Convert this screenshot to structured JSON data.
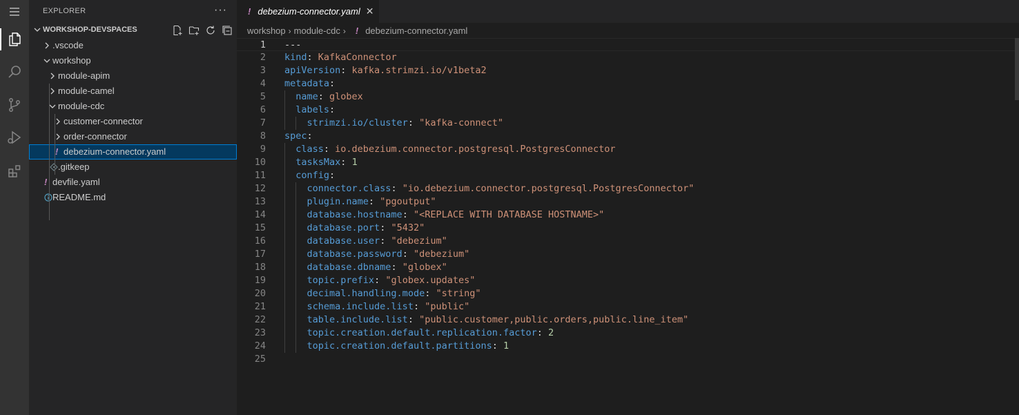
{
  "sidebar": {
    "title": "EXPLORER",
    "more_label": "···",
    "section_title": "WORKSHOP-DEVSPACES",
    "tree": [
      {
        "label": ".vscode",
        "type": "folder",
        "expanded": false,
        "depth": 0
      },
      {
        "label": "workshop",
        "type": "folder",
        "expanded": true,
        "depth": 0
      },
      {
        "label": "module-apim",
        "type": "folder",
        "expanded": false,
        "depth": 1
      },
      {
        "label": "module-camel",
        "type": "folder",
        "expanded": false,
        "depth": 1
      },
      {
        "label": "module-cdc",
        "type": "folder",
        "expanded": true,
        "depth": 1
      },
      {
        "label": "customer-connector",
        "type": "folder",
        "expanded": false,
        "depth": 2
      },
      {
        "label": "order-connector",
        "type": "folder",
        "expanded": false,
        "depth": 2
      },
      {
        "label": "debezium-connector.yaml",
        "type": "yaml",
        "depth": 2,
        "selected": true
      },
      {
        "label": ".gitkeep",
        "type": "gitkeep",
        "depth": 1
      },
      {
        "label": "devfile.yaml",
        "type": "yaml",
        "depth": 0
      },
      {
        "label": "README.md",
        "type": "info",
        "depth": 0
      }
    ]
  },
  "editor": {
    "tab_label": "debezium-connector.yaml",
    "tab_icon": "!",
    "close_glyph": "✕",
    "breadcrumbs": [
      "workshop",
      "module-cdc",
      "debezium-connector.yaml"
    ],
    "breadcrumb_sep": "›",
    "current_line": 1,
    "lines": [
      [
        [
          "p",
          "---"
        ]
      ],
      [
        [
          "k",
          "kind"
        ],
        [
          "p",
          ": "
        ],
        [
          "s",
          "KafkaConnector"
        ]
      ],
      [
        [
          "k",
          "apiVersion"
        ],
        [
          "p",
          ": "
        ],
        [
          "s",
          "kafka.strimzi.io/v1beta2"
        ]
      ],
      [
        [
          "k",
          "metadata"
        ],
        [
          "p",
          ":"
        ]
      ],
      [
        [
          "p",
          "  "
        ],
        [
          "k",
          "name"
        ],
        [
          "p",
          ": "
        ],
        [
          "s",
          "globex"
        ]
      ],
      [
        [
          "p",
          "  "
        ],
        [
          "k",
          "labels"
        ],
        [
          "p",
          ":"
        ]
      ],
      [
        [
          "p",
          "    "
        ],
        [
          "k",
          "strimzi.io/cluster"
        ],
        [
          "p",
          ": "
        ],
        [
          "s",
          "\"kafka-connect\""
        ]
      ],
      [
        [
          "k",
          "spec"
        ],
        [
          "p",
          ":"
        ]
      ],
      [
        [
          "p",
          "  "
        ],
        [
          "k",
          "class"
        ],
        [
          "p",
          ": "
        ],
        [
          "s",
          "io.debezium.connector.postgresql.PostgresConnector"
        ]
      ],
      [
        [
          "p",
          "  "
        ],
        [
          "k",
          "tasksMax"
        ],
        [
          "p",
          ": "
        ],
        [
          "n",
          "1"
        ]
      ],
      [
        [
          "p",
          "  "
        ],
        [
          "k",
          "config"
        ],
        [
          "p",
          ":"
        ]
      ],
      [
        [
          "p",
          "    "
        ],
        [
          "k",
          "connector.class"
        ],
        [
          "p",
          ": "
        ],
        [
          "s",
          "\"io.debezium.connector.postgresql.PostgresConnector\""
        ]
      ],
      [
        [
          "p",
          "    "
        ],
        [
          "k",
          "plugin.name"
        ],
        [
          "p",
          ": "
        ],
        [
          "s",
          "\"pgoutput\""
        ]
      ],
      [
        [
          "p",
          "    "
        ],
        [
          "k",
          "database.hostname"
        ],
        [
          "p",
          ": "
        ],
        [
          "s",
          "\"<REPLACE WITH DATABASE HOSTNAME>\""
        ]
      ],
      [
        [
          "p",
          "    "
        ],
        [
          "k",
          "database.port"
        ],
        [
          "p",
          ": "
        ],
        [
          "s",
          "\"5432\""
        ]
      ],
      [
        [
          "p",
          "    "
        ],
        [
          "k",
          "database.user"
        ],
        [
          "p",
          ": "
        ],
        [
          "s",
          "\"debezium\""
        ]
      ],
      [
        [
          "p",
          "    "
        ],
        [
          "k",
          "database.password"
        ],
        [
          "p",
          ": "
        ],
        [
          "s",
          "\"debezium\""
        ]
      ],
      [
        [
          "p",
          "    "
        ],
        [
          "k",
          "database.dbname"
        ],
        [
          "p",
          ": "
        ],
        [
          "s",
          "\"globex\""
        ]
      ],
      [
        [
          "p",
          "    "
        ],
        [
          "k",
          "topic.prefix"
        ],
        [
          "p",
          ": "
        ],
        [
          "s",
          "\"globex.updates\""
        ]
      ],
      [
        [
          "p",
          "    "
        ],
        [
          "k",
          "decimal.handling.mode"
        ],
        [
          "p",
          ": "
        ],
        [
          "s",
          "\"string\""
        ]
      ],
      [
        [
          "p",
          "    "
        ],
        [
          "k",
          "schema.include.list"
        ],
        [
          "p",
          ": "
        ],
        [
          "s",
          "\"public\""
        ]
      ],
      [
        [
          "p",
          "    "
        ],
        [
          "k",
          "table.include.list"
        ],
        [
          "p",
          ": "
        ],
        [
          "s",
          "\"public.customer,public.orders,public.line_item\""
        ]
      ],
      [
        [
          "p",
          "    "
        ],
        [
          "k",
          "topic.creation.default.replication.factor"
        ],
        [
          "p",
          ": "
        ],
        [
          "n",
          "2"
        ]
      ],
      [
        [
          "p",
          "    "
        ],
        [
          "k",
          "topic.creation.default.partitions"
        ],
        [
          "p",
          ": "
        ],
        [
          "n",
          "1"
        ]
      ],
      []
    ]
  },
  "colors": {
    "key": "#569cd6",
    "string": "#ce9178",
    "number": "#b5cea8",
    "yaml_icon": "#c586c0",
    "info_icon": "#519aba",
    "selection": "#04395e"
  },
  "icons": {
    "activity": [
      "menu-icon",
      "files-icon",
      "search-icon",
      "source-control-icon",
      "run-debug-icon",
      "extensions-icon"
    ],
    "section_actions": [
      "new-file-icon",
      "new-folder-icon",
      "refresh-icon",
      "collapse-all-icon"
    ]
  }
}
